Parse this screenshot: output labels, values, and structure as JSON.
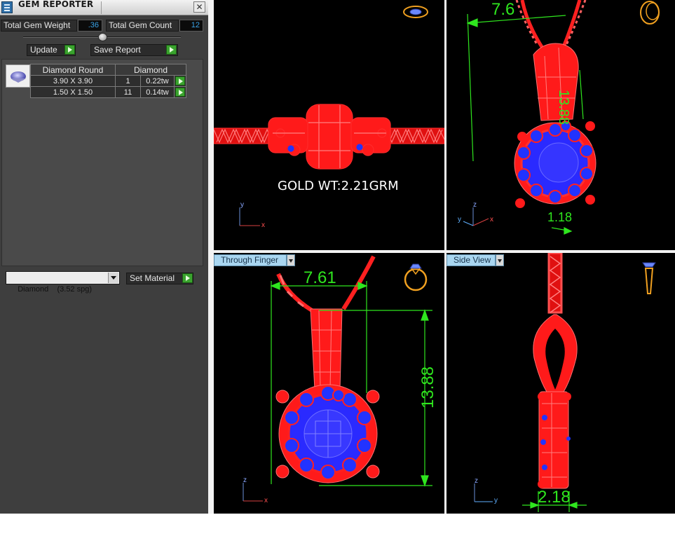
{
  "window": {
    "title": "GEM REPORTER"
  },
  "summary": {
    "total_weight_label": "Total Gem Weight",
    "total_weight_value": ".36",
    "total_count_label": "Total Gem Count",
    "total_count_value": "12"
  },
  "buttons": {
    "update": "Update",
    "save_report": "Save Report",
    "set_material": "Set Material"
  },
  "gem_table": {
    "headers": [
      "Diamond Round",
      "Diamond"
    ],
    "rows": [
      {
        "size": "3.90 X 3.90",
        "qty": "1",
        "weight": "0.22tw"
      },
      {
        "size": "1.50 X 1.50",
        "qty": "11",
        "weight": "0.14tw"
      }
    ]
  },
  "material": {
    "selected": "Diamond    (3.52 spg)"
  },
  "viewports": {
    "top_left": {
      "annotation": "GOLD WT:2.21GRM",
      "axis_v": "y",
      "axis_h": "x"
    },
    "top_right": {
      "dim_width": "7.6",
      "dim_height": "13.88",
      "dim_depth": "1.18",
      "axis_v": "z",
      "axis_h": "x",
      "axis_d": "y"
    },
    "bottom_left": {
      "tab": "Through Finger",
      "dim_width": "7.61",
      "dim_height": "13.88",
      "axis_v": "z",
      "axis_h": "x"
    },
    "bottom_right": {
      "tab": "Side View",
      "dim_depth": "2.18",
      "axis_v": "z",
      "axis_h": "y"
    }
  },
  "colors": {
    "metal": "#ff1a1a",
    "stones": "#2233ff",
    "dimension": "#2fe61e",
    "viewport_bg": "#000000"
  }
}
